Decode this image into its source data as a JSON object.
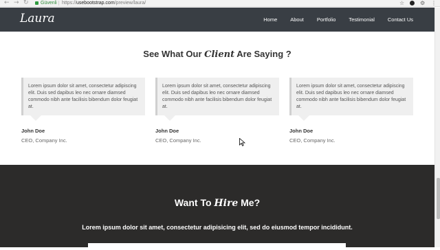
{
  "browser": {
    "back_icon": "arrow-left-icon",
    "forward_icon": "arrow-right-icon",
    "reload_icon": "reload-icon",
    "secure_label": "Güvenli",
    "url": {
      "scheme": "https://",
      "host": "usebootstrap.com",
      "path": "/preview/laura/"
    },
    "bookmark_icon": "star-icon",
    "extension_icons": [
      "extension-dark-icon",
      "settings-icon",
      "menu-icon"
    ]
  },
  "header": {
    "logo": "Laura",
    "nav": [
      "Home",
      "About",
      "Portfolio",
      "Testimonial",
      "Contact Us"
    ],
    "background": "#393e44"
  },
  "testimonials": {
    "title_before": "See What Our ",
    "title_script": "Client",
    "title_after": " Are Saying ?",
    "items": [
      {
        "quote": "Lorem ipsum dolor sit amet, consectetur adipiscing elit. Duis sed dapibus leo nec ornare diamsed commodo nibh ante facilisis bibendum dolor feugiat at.",
        "name": "John Doe",
        "role": "CEO, Company Inc."
      },
      {
        "quote": "Lorem ipsum dolor sit amet, consectetur adipiscing elit. Duis sed dapibus leo nec ornare diamsed commodo nibh ante facilisis bibendum dolor feugiat at.",
        "name": "John Doe",
        "role": "CEO, Company Inc."
      },
      {
        "quote": "Lorem ipsum dolor sit amet, consectetur adipiscing elit. Duis sed dapibus leo nec ornare diamsed commodo nibh ante facilisis bibendum dolor feugiat at.",
        "name": "John Doe",
        "role": "CEO, Company Inc."
      }
    ]
  },
  "hire": {
    "title_before": "Want To ",
    "title_script": "Hire",
    "title_after": " Me?",
    "text": "Lorem ipsum dolor sit amet, consectetur adipisicing elit, sed do eiusmod tempor incididunt.",
    "background": "#2c2b2a"
  }
}
